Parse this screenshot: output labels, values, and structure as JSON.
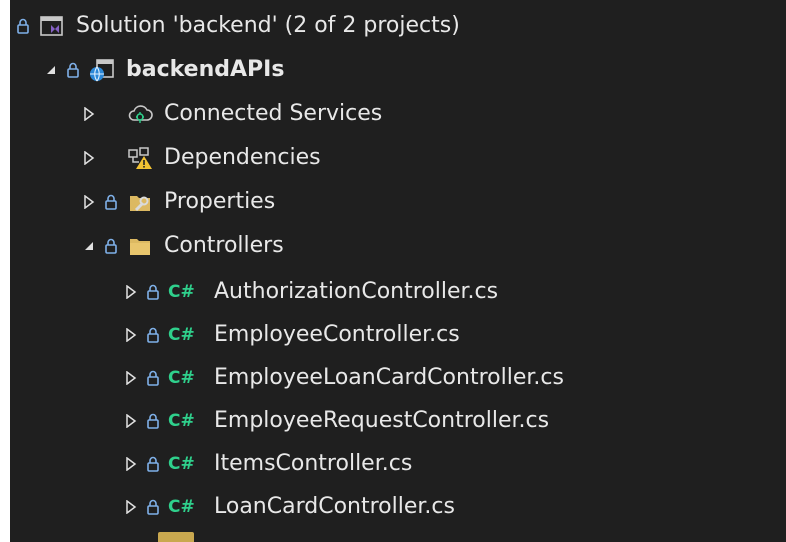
{
  "tree": {
    "solution": {
      "label": "Solution 'backend' (2 of 2 projects)",
      "icon": "solution-icon"
    },
    "project": {
      "label": "backendAPIs",
      "icon": "web-project-icon"
    },
    "nodes": [
      {
        "label": "Connected Services",
        "icon": "connected-services-icon"
      },
      {
        "label": "Dependencies",
        "icon": "dependencies-warning-icon"
      },
      {
        "label": "Properties",
        "icon": "properties-folder-icon"
      },
      {
        "label": "Controllers",
        "icon": "folder-icon"
      }
    ],
    "cs_prefix": "C#",
    "files": [
      {
        "label": "AuthorizationController.cs"
      },
      {
        "label": "EmployeeController.cs"
      },
      {
        "label": "EmployeeLoanCardController.cs"
      },
      {
        "label": "EmployeeRequestController.cs"
      },
      {
        "label": "ItemsController.cs"
      },
      {
        "label": "LoanCardController.cs"
      }
    ]
  },
  "colors": {
    "background": "#1f1f1f",
    "text": "#e8e8e8",
    "csharp": "#2fd08c",
    "lock": "#7fb0e8",
    "folder": "#dcb962",
    "solution": "#8661c5"
  }
}
